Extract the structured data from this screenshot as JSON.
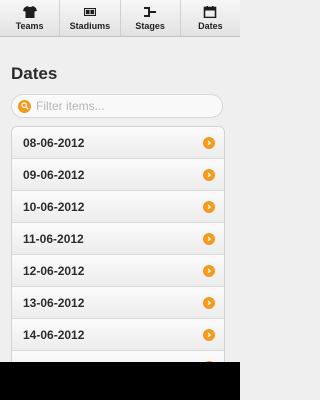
{
  "tabs": [
    {
      "label": "Teams",
      "icon": "shirt-icon"
    },
    {
      "label": "Stadiums",
      "icon": "stadium-icon"
    },
    {
      "label": "Stages",
      "icon": "bracket-icon"
    },
    {
      "label": "Dates",
      "icon": "calendar-icon"
    }
  ],
  "page_title": "Dates",
  "search": {
    "placeholder": "Filter items...",
    "icon": "search-icon"
  },
  "dates": [
    "08-06-2012",
    "09-06-2012",
    "10-06-2012",
    "11-06-2012",
    "12-06-2012",
    "13-06-2012",
    "14-06-2012"
  ],
  "colors": {
    "accent": "#f29a1e",
    "background": "#efefef"
  }
}
